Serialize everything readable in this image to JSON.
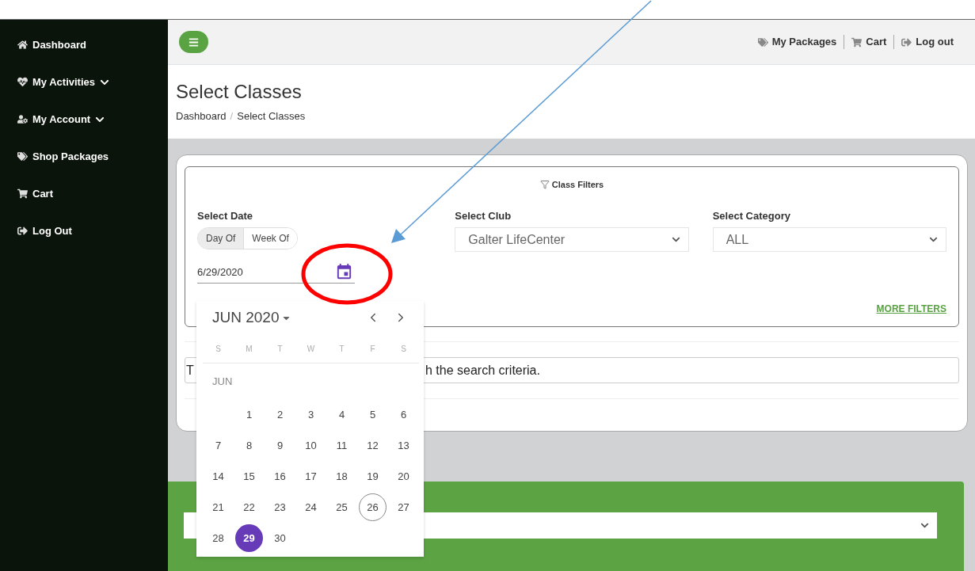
{
  "sidebar": {
    "items": [
      {
        "label": "Dashboard",
        "expandable": false
      },
      {
        "label": "My Activities",
        "expandable": true
      },
      {
        "label": "My Account",
        "expandable": true
      },
      {
        "label": "Shop Packages",
        "expandable": false
      },
      {
        "label": "Cart",
        "expandable": false
      },
      {
        "label": "Log Out",
        "expandable": false
      }
    ]
  },
  "header": {
    "links": [
      {
        "label": "My Packages"
      },
      {
        "label": "Cart"
      },
      {
        "label": "Log out"
      }
    ]
  },
  "page": {
    "title": "Select Classes",
    "breadcrumb": [
      "Dashboard",
      "Select Classes"
    ],
    "breadcrumb_separator": "/"
  },
  "filters": {
    "title": "Class Filters",
    "date": {
      "label": "Select Date",
      "modes": [
        {
          "label": "Day Of",
          "selected": true
        },
        {
          "label": "Week Of",
          "selected": false
        }
      ],
      "value": "6/29/2020"
    },
    "club": {
      "label": "Select Club",
      "value": "Galter LifeCenter"
    },
    "category": {
      "label": "Select Category",
      "value": "ALL"
    },
    "more_link": "MORE FILTERS"
  },
  "message": {
    "visible_start": "T",
    "visible_end": "h the search criteria."
  },
  "datepicker": {
    "month_label": "JUN 2020",
    "weekdays": [
      "S",
      "M",
      "T",
      "W",
      "T",
      "F",
      "S"
    ],
    "section_label": "JUN",
    "weeks": [
      [
        {
          "kind": "blank"
        },
        {
          "kind": "day",
          "label": "1",
          "selected": false,
          "today": false
        },
        {
          "kind": "day",
          "label": "2",
          "selected": false,
          "today": false
        },
        {
          "kind": "day",
          "label": "3",
          "selected": false,
          "today": false
        },
        {
          "kind": "day",
          "label": "4",
          "selected": false,
          "today": false
        },
        {
          "kind": "day",
          "label": "5",
          "selected": false,
          "today": false
        },
        {
          "kind": "day",
          "label": "6",
          "selected": false,
          "today": false
        }
      ],
      [
        {
          "kind": "day",
          "label": "7",
          "selected": false,
          "today": false
        },
        {
          "kind": "day",
          "label": "8",
          "selected": false,
          "today": false
        },
        {
          "kind": "day",
          "label": "9",
          "selected": false,
          "today": false
        },
        {
          "kind": "day",
          "label": "10",
          "selected": false,
          "today": false
        },
        {
          "kind": "day",
          "label": "11",
          "selected": false,
          "today": false
        },
        {
          "kind": "day",
          "label": "12",
          "selected": false,
          "today": false
        },
        {
          "kind": "day",
          "label": "13",
          "selected": false,
          "today": false
        }
      ],
      [
        {
          "kind": "day",
          "label": "14",
          "selected": false,
          "today": false
        },
        {
          "kind": "day",
          "label": "15",
          "selected": false,
          "today": false
        },
        {
          "kind": "day",
          "label": "16",
          "selected": false,
          "today": false
        },
        {
          "kind": "day",
          "label": "17",
          "selected": false,
          "today": false
        },
        {
          "kind": "day",
          "label": "18",
          "selected": false,
          "today": false
        },
        {
          "kind": "day",
          "label": "19",
          "selected": false,
          "today": false
        },
        {
          "kind": "day",
          "label": "20",
          "selected": false,
          "today": false
        }
      ],
      [
        {
          "kind": "day",
          "label": "21",
          "selected": false,
          "today": false
        },
        {
          "kind": "day",
          "label": "22",
          "selected": false,
          "today": false
        },
        {
          "kind": "day",
          "label": "23",
          "selected": false,
          "today": false
        },
        {
          "kind": "day",
          "label": "24",
          "selected": false,
          "today": false
        },
        {
          "kind": "day",
          "label": "25",
          "selected": false,
          "today": false
        },
        {
          "kind": "day",
          "label": "26",
          "selected": false,
          "today": true
        },
        {
          "kind": "day",
          "label": "27",
          "selected": false,
          "today": false
        }
      ],
      [
        {
          "kind": "day",
          "label": "28",
          "selected": false,
          "today": false
        },
        {
          "kind": "day",
          "label": "29",
          "selected": true,
          "today": false
        },
        {
          "kind": "day",
          "label": "30",
          "selected": false,
          "today": false
        }
      ]
    ]
  },
  "annotations": [
    {
      "kind": "ellipse",
      "color": "#ff0000"
    },
    {
      "kind": "arrow",
      "color": "#5b9bd5"
    }
  ]
}
